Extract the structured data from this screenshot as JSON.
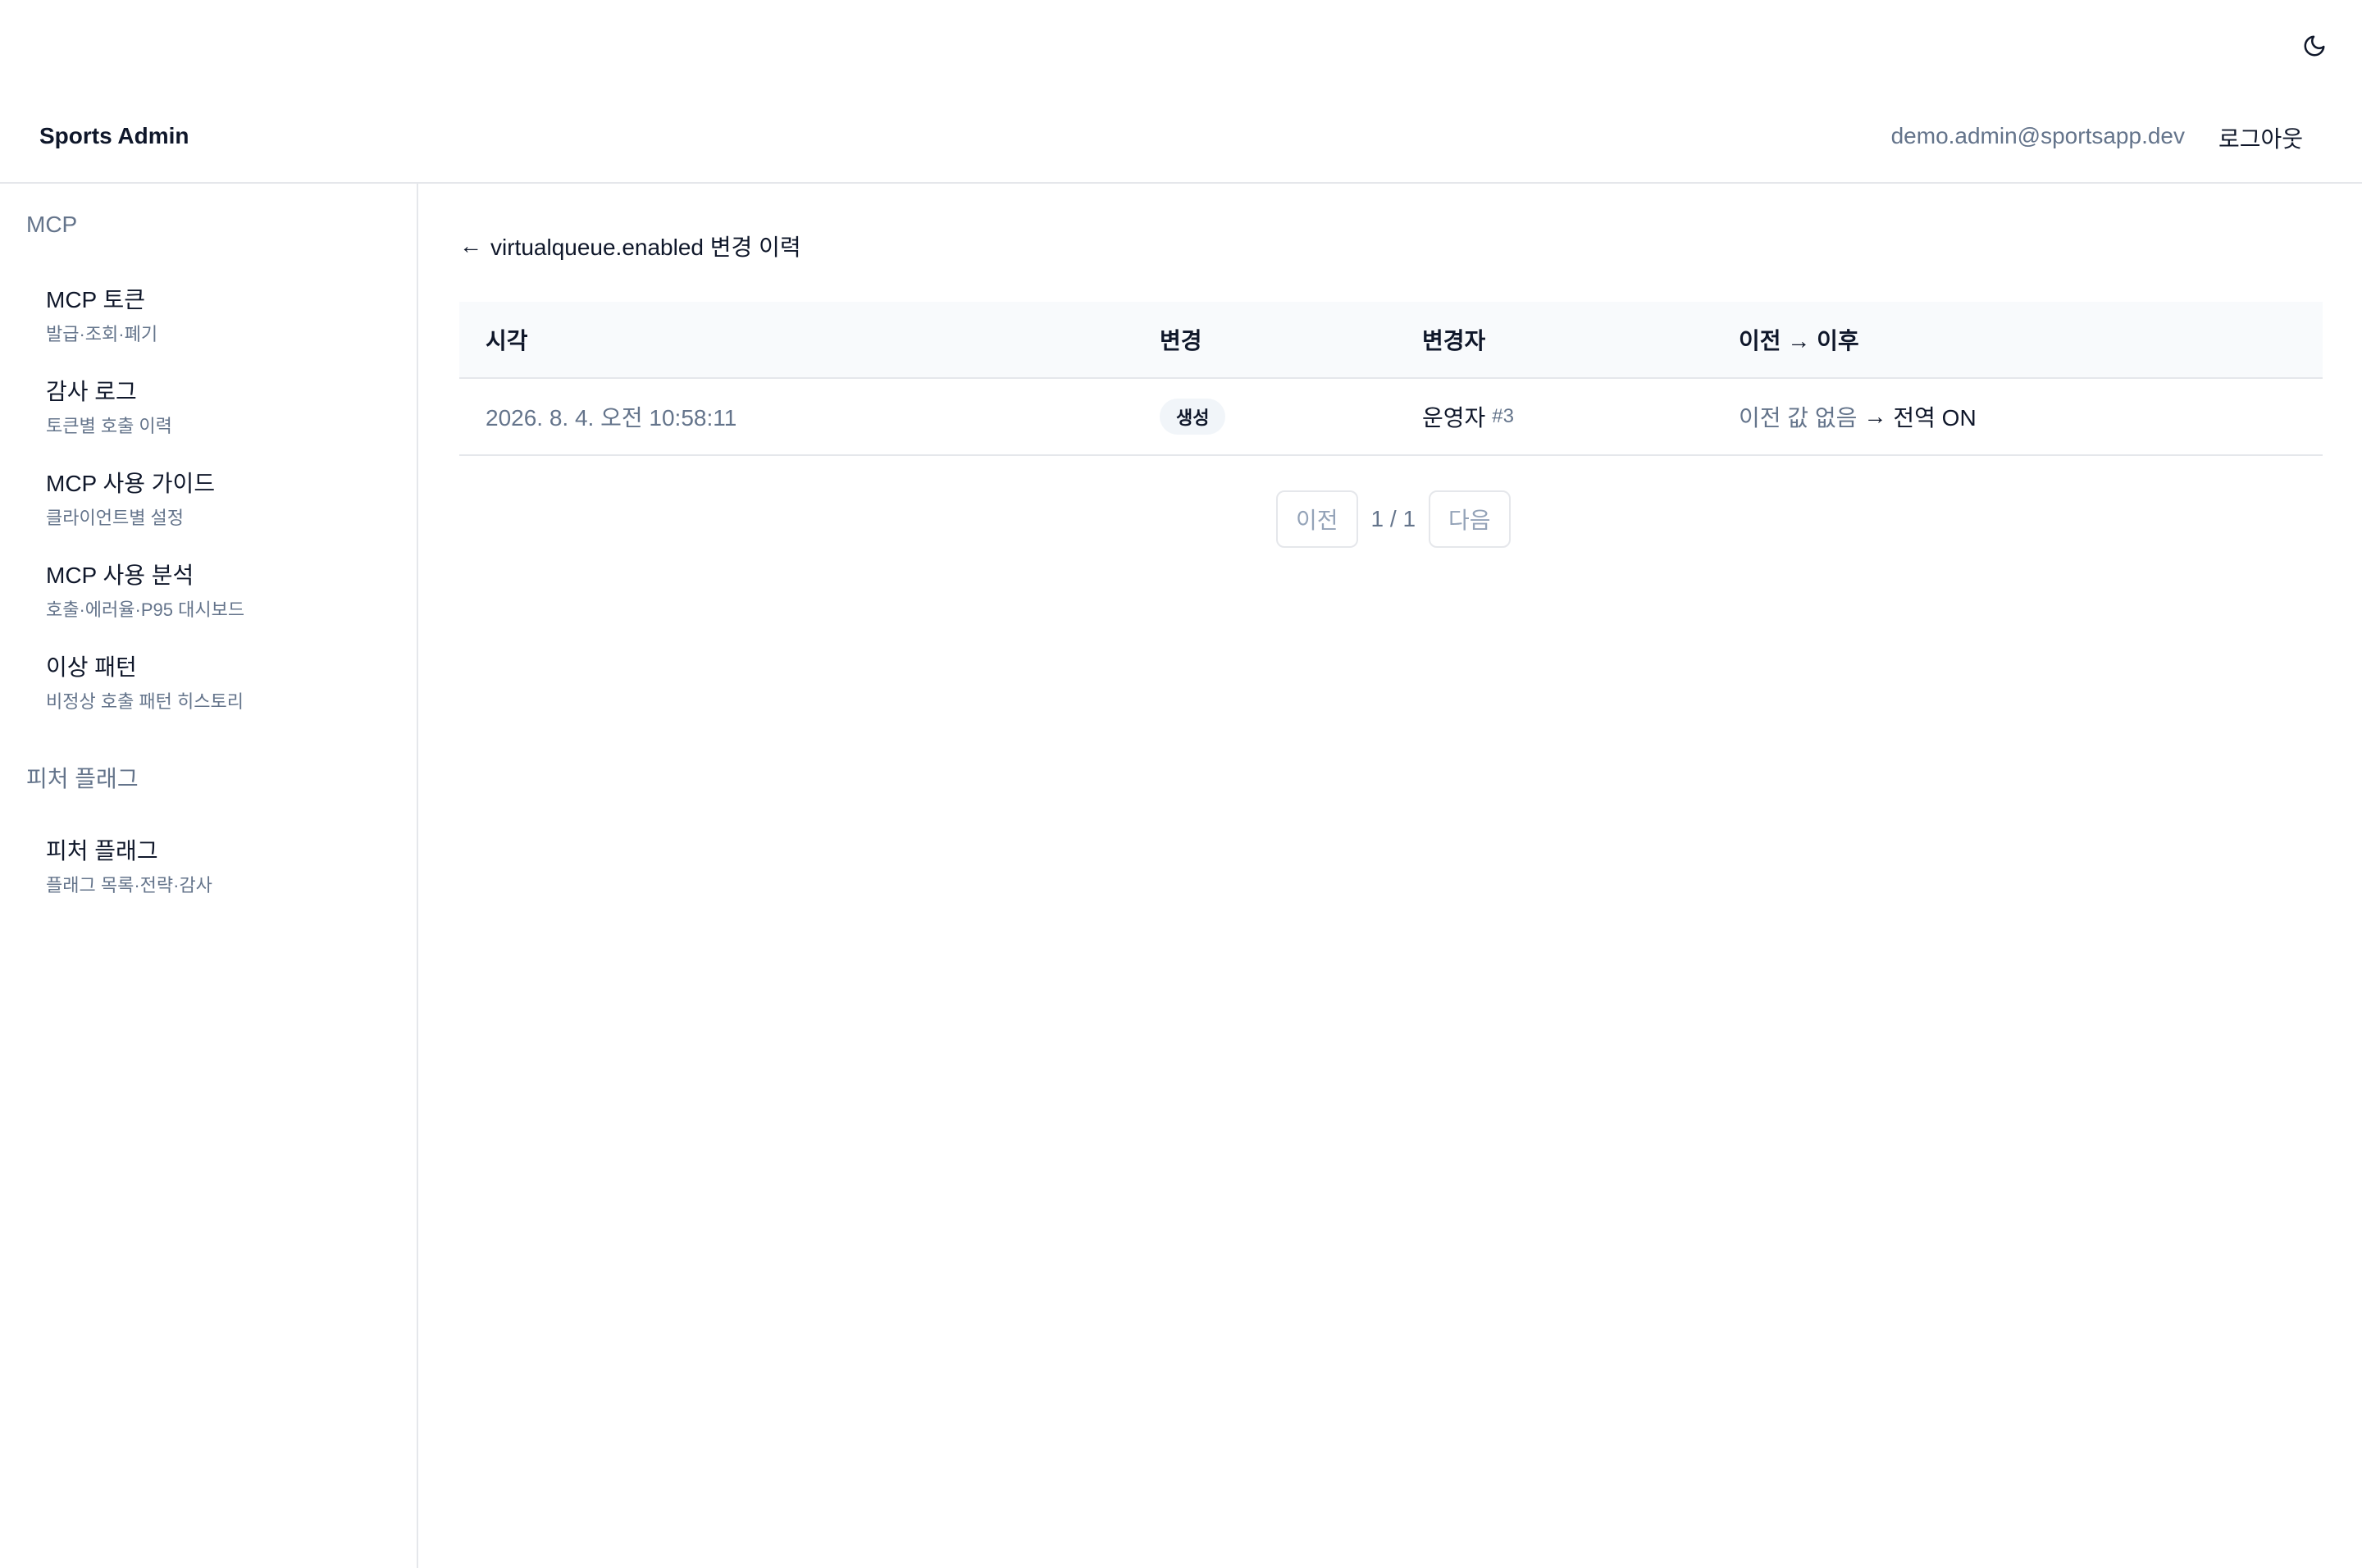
{
  "header": {
    "brand": "Sports Admin",
    "user_email": "demo.admin@sportsapp.dev",
    "logout_label": "로그아웃",
    "theme_icon": "moon-icon"
  },
  "sidebar": {
    "sections": [
      {
        "title": "MCP",
        "items": [
          {
            "label": "MCP 토큰",
            "desc": "발급·조회·폐기"
          },
          {
            "label": "감사 로그",
            "desc": "토큰별 호출 이력"
          },
          {
            "label": "MCP 사용 가이드",
            "desc": "클라이언트별 설정"
          },
          {
            "label": "MCP 사용 분석",
            "desc": "호출·에러율·P95 대시보드"
          },
          {
            "label": "이상 패턴",
            "desc": "비정상 호출 패턴 히스토리"
          }
        ]
      },
      {
        "title": "피처 플래그",
        "items": [
          {
            "label": "피처 플래그",
            "desc": "플래그 목록·전략·감사"
          }
        ]
      }
    ]
  },
  "main": {
    "back_arrow": "←",
    "title": "virtualqueue.enabled 변경 이력",
    "table": {
      "headers": [
        "시각",
        "변경",
        "변경자",
        "이전 → 이후"
      ],
      "rows": [
        {
          "time": "2026. 8. 4. 오전 10:58:11",
          "change": "생성",
          "actor": "운영자",
          "actor_id": "#3",
          "before": "이전 값 없음",
          "arrow": "→",
          "after": "전역 ON"
        }
      ]
    },
    "pagination": {
      "prev_label": "이전",
      "indicator": "1 / 1",
      "next_label": "다음"
    }
  },
  "colors": {
    "text": "#0f172a",
    "muted": "#64748b",
    "border": "#e5e7eb",
    "header_bg": "#f8fafc",
    "badge_bg": "#f1f5f9"
  }
}
